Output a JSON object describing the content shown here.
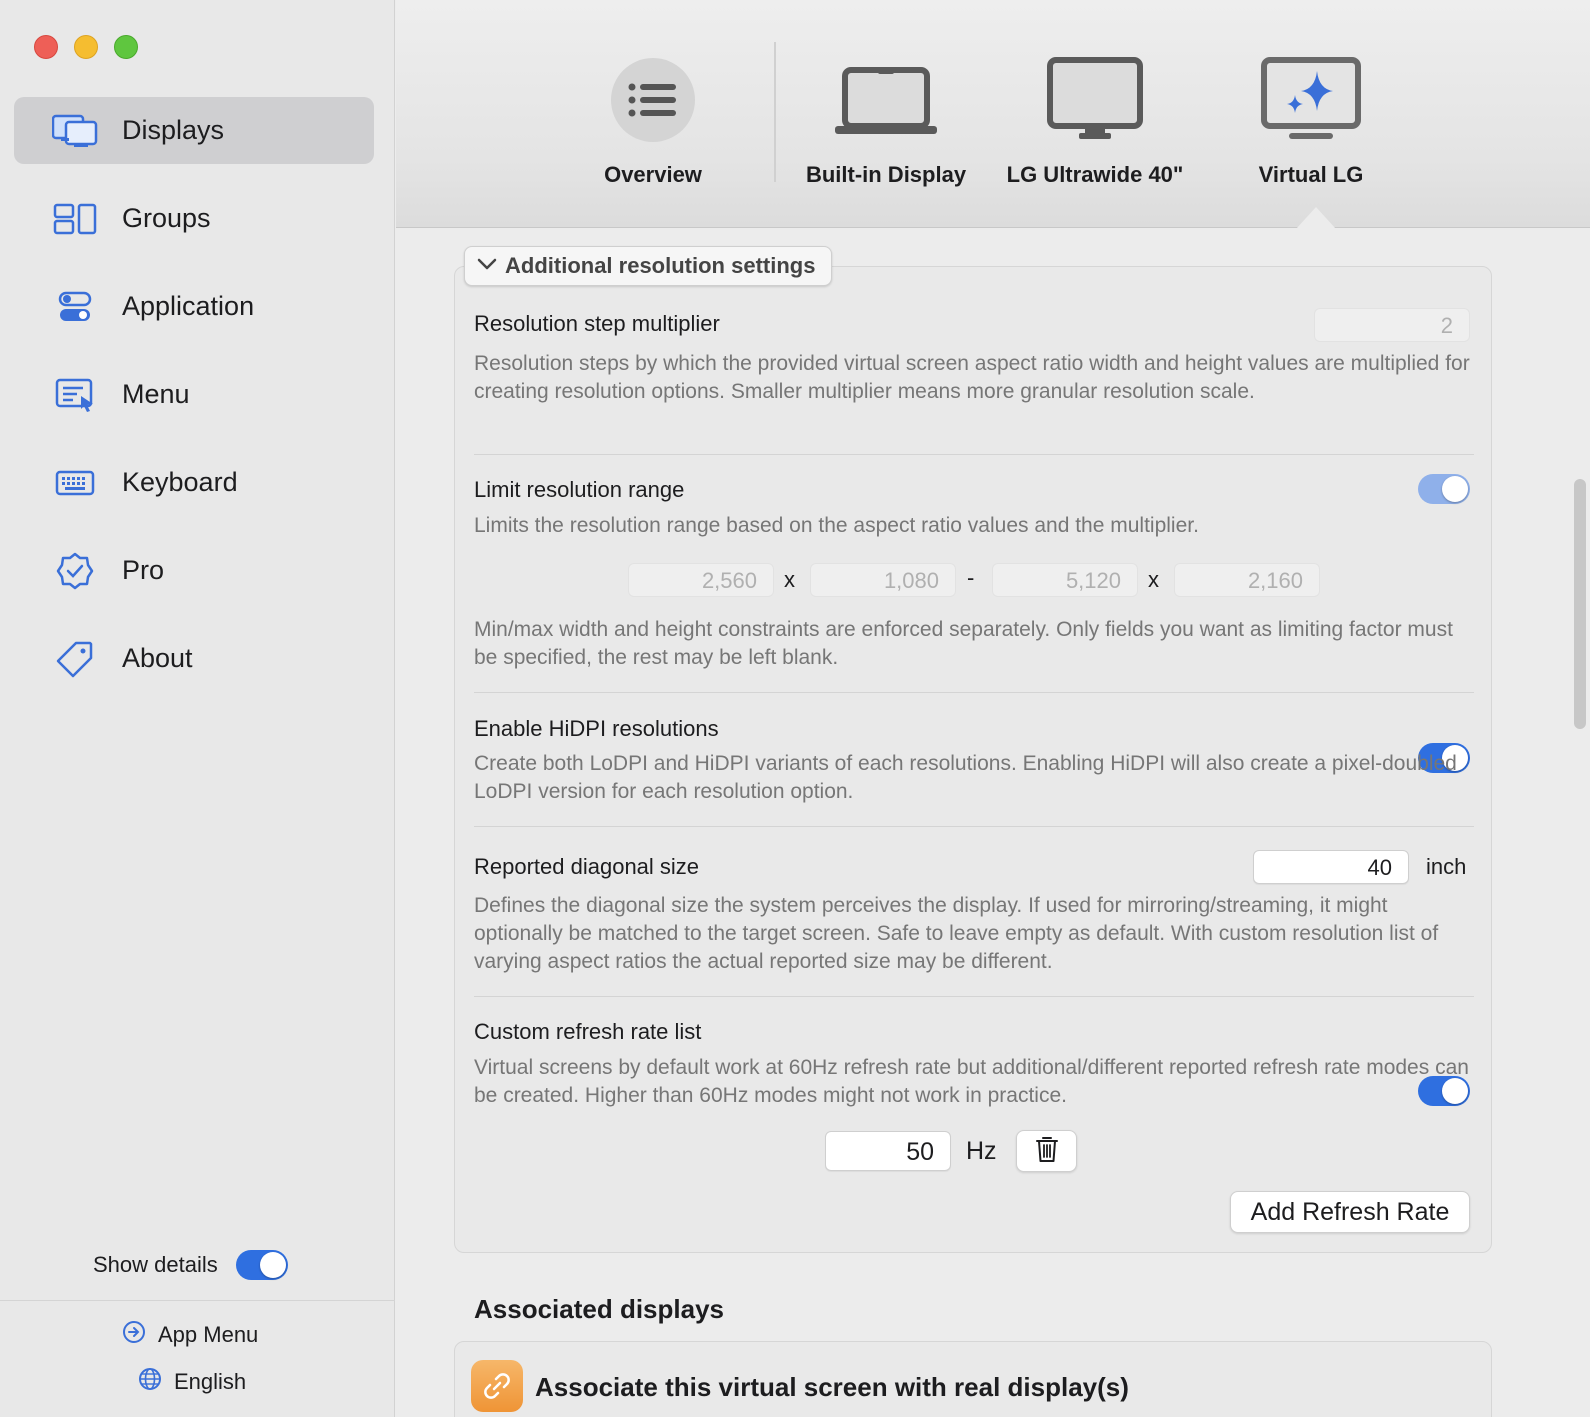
{
  "sidebar": {
    "items": [
      {
        "label": "Displays",
        "icon": "displays-icon"
      },
      {
        "label": "Groups",
        "icon": "groups-icon"
      },
      {
        "label": "Application",
        "icon": "application-icon"
      },
      {
        "label": "Menu",
        "icon": "menu-icon"
      },
      {
        "label": "Keyboard",
        "icon": "keyboard-icon"
      },
      {
        "label": "Pro",
        "icon": "pro-badge-icon"
      },
      {
        "label": "About",
        "icon": "tag-icon"
      }
    ],
    "selected": "Displays",
    "show_details_label": "Show details",
    "show_details_on": true,
    "app_menu_label": "App Menu",
    "language_label": "English"
  },
  "toolbar": {
    "tabs": [
      {
        "label": "Overview",
        "icon": "list-icon"
      },
      {
        "label": "Built-in Display",
        "icon": "laptop-icon"
      },
      {
        "label": "LG Ultrawide 40\"",
        "icon": "monitor-icon"
      },
      {
        "label": "Virtual LG",
        "icon": "virtual-monitor-icon"
      }
    ],
    "selected": "Virtual LG"
  },
  "settings": {
    "section_toggle_label": "Additional resolution settings",
    "step_multiplier": {
      "title": "Resolution step multiplier",
      "value": "2",
      "description": "Resolution steps by which the provided virtual screen aspect ratio width and height values are multiplied for creating resolution options. Smaller multiplier means more granular resolution scale."
    },
    "limit_range": {
      "title": "Limit resolution range",
      "enabled": true,
      "description": "Limits the resolution range based on the aspect ratio values and the multiplier.",
      "min_width": "2,560",
      "min_height": "1,080",
      "max_width": "5,120",
      "max_height": "2,160",
      "x_sep": "x",
      "range_sep": "-",
      "note": "Min/max width and height constraints are enforced separately. Only fields you want as limiting factor must be specified, the rest may be left blank."
    },
    "hidpi": {
      "title": "Enable HiDPI resolutions",
      "enabled": true,
      "description": "Create both LoDPI and HiDPI variants of each resolutions. Enabling HiDPI will also create a pixel-doubled LoDPI version for each resolution option."
    },
    "diagonal": {
      "title": "Reported diagonal size",
      "value": "40",
      "unit": "inch",
      "description": "Defines the diagonal size the system perceives the display. If used for mirroring/streaming, it might optionally be matched to the target screen. Safe to leave empty as default. With custom resolution list of varying aspect ratios the actual reported size may be different."
    },
    "refresh": {
      "title": "Custom refresh rate list",
      "enabled": true,
      "description": "Virtual screens by default work at 60Hz refresh rate but additional/different reported refresh rate modes can be created. Higher than 60Hz modes might not work in practice.",
      "rate_value": "50",
      "rate_unit": "Hz",
      "add_button_label": "Add Refresh Rate"
    }
  },
  "associated": {
    "section_title": "Associated displays",
    "card_title": "Associate this virtual screen with real display(s)"
  },
  "colors": {
    "accent": "#2f6fe0",
    "selected_sidebar": "#cfcfd1",
    "icon_blue": "#3a6fd8"
  }
}
